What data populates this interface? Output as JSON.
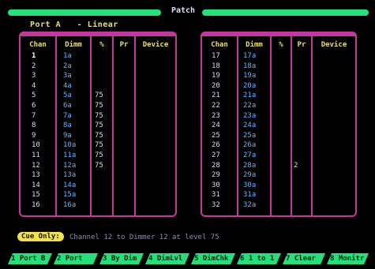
{
  "title": "Patch",
  "subtitle": {
    "port": "Port A",
    "mode": "- Linear"
  },
  "left_table": {
    "headers": [
      "Chan",
      "Dimm",
      "%",
      "Pr",
      "Device"
    ],
    "rows": [
      {
        "chan": "1",
        "dimm": "1a",
        "pct": "",
        "pr": "",
        "device": ""
      },
      {
        "chan": "2",
        "dimm": "2a",
        "pct": "",
        "pr": "",
        "device": ""
      },
      {
        "chan": "3",
        "dimm": "3a",
        "pct": "",
        "pr": "",
        "device": ""
      },
      {
        "chan": "4",
        "dimm": "4a",
        "pct": "",
        "pr": "",
        "device": ""
      },
      {
        "chan": "5",
        "dimm": "5a",
        "pct": "75",
        "pr": "",
        "device": ""
      },
      {
        "chan": "6",
        "dimm": "6a",
        "pct": "75",
        "pr": "",
        "device": ""
      },
      {
        "chan": "7",
        "dimm": "7a",
        "pct": "75",
        "pr": "",
        "device": ""
      },
      {
        "chan": "8",
        "dimm": "8a",
        "pct": "75",
        "pr": "",
        "device": ""
      },
      {
        "chan": "9",
        "dimm": "9a",
        "pct": "75",
        "pr": "",
        "device": ""
      },
      {
        "chan": "10",
        "dimm": "10a",
        "pct": "75",
        "pr": "",
        "device": ""
      },
      {
        "chan": "11",
        "dimm": "11a",
        "pct": "75",
        "pr": "",
        "device": ""
      },
      {
        "chan": "12",
        "dimm": "12a",
        "pct": "75",
        "pr": "",
        "device": ""
      },
      {
        "chan": "13",
        "dimm": "13a",
        "pct": "",
        "pr": "",
        "device": ""
      },
      {
        "chan": "14",
        "dimm": "14a",
        "pct": "",
        "pr": "",
        "device": ""
      },
      {
        "chan": "15",
        "dimm": "15a",
        "pct": "",
        "pr": "",
        "device": ""
      },
      {
        "chan": "16",
        "dimm": "16a",
        "pct": "",
        "pr": "",
        "device": ""
      }
    ]
  },
  "right_table": {
    "headers": [
      "Chan",
      "Dimm",
      "%",
      "Pr",
      "Device"
    ],
    "rows": [
      {
        "chan": "17",
        "dimm": "17a",
        "pct": "",
        "pr": "",
        "device": ""
      },
      {
        "chan": "18",
        "dimm": "18a",
        "pct": "",
        "pr": "",
        "device": ""
      },
      {
        "chan": "19",
        "dimm": "19a",
        "pct": "",
        "pr": "",
        "device": ""
      },
      {
        "chan": "20",
        "dimm": "20a",
        "pct": "",
        "pr": "",
        "device": ""
      },
      {
        "chan": "21",
        "dimm": "21a",
        "pct": "",
        "pr": "",
        "device": ""
      },
      {
        "chan": "22",
        "dimm": "22a",
        "pct": "",
        "pr": "",
        "device": ""
      },
      {
        "chan": "23",
        "dimm": "23a",
        "pct": "",
        "pr": "",
        "device": ""
      },
      {
        "chan": "24",
        "dimm": "24a",
        "pct": "",
        "pr": "",
        "device": ""
      },
      {
        "chan": "25",
        "dimm": "25a",
        "pct": "",
        "pr": "",
        "device": ""
      },
      {
        "chan": "26",
        "dimm": "26a",
        "pct": "",
        "pr": "",
        "device": ""
      },
      {
        "chan": "27",
        "dimm": "27a",
        "pct": "",
        "pr": "",
        "device": ""
      },
      {
        "chan": "28",
        "dimm": "28a",
        "pct": "",
        "pr": "2",
        "device": ""
      },
      {
        "chan": "29",
        "dimm": "29a",
        "pct": "",
        "pr": "",
        "device": ""
      },
      {
        "chan": "30",
        "dimm": "30a",
        "pct": "",
        "pr": "",
        "device": ""
      },
      {
        "chan": "31",
        "dimm": "31a",
        "pct": "",
        "pr": "",
        "device": ""
      },
      {
        "chan": "32",
        "dimm": "32a",
        "pct": "",
        "pr": "",
        "device": ""
      }
    ]
  },
  "status": {
    "badge": "Cue Only:",
    "message": "Channel 12 to Dimmer 12 at level 75"
  },
  "function_keys": [
    "1 Port B",
    "2 Port",
    "3 By Dim",
    "4 DimLvl",
    "5 DimChk",
    "6 1 to 1",
    "7 Clear",
    "8 Monitr"
  ],
  "colors": {
    "accent_green": "#25e07a",
    "panel_border": "#c4379e",
    "header_yellow": "#e8e070",
    "dimmer_blue": "#66b3ff",
    "status_yellow": "#f1e24c"
  }
}
